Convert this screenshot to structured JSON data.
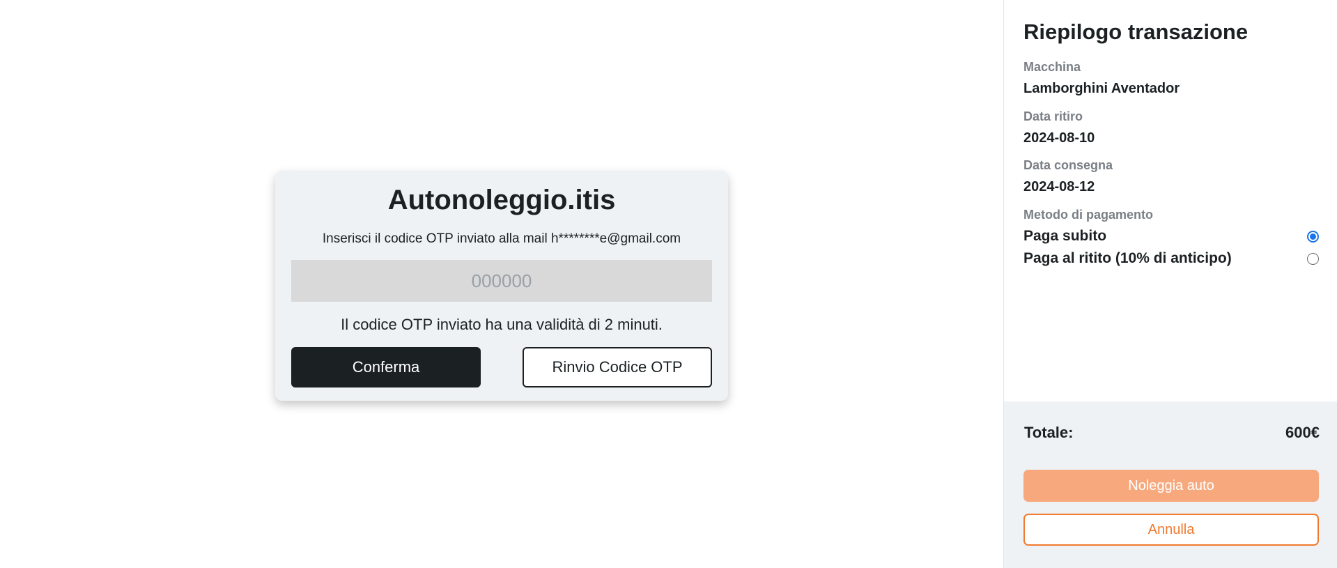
{
  "otp": {
    "title": "Autonoleggio.itis",
    "instructions": "Inserisci il codice OTP inviato alla mail h********e@gmail.com",
    "input_placeholder": "000000",
    "input_value": "",
    "validity": "Il codice OTP inviato ha una validità di 2 minuti.",
    "confirm_label": "Conferma",
    "resend_label": "Rinvio Codice OTP"
  },
  "summary": {
    "title": "Riepilogo transazione",
    "car_label": "Macchina",
    "car_value": "Lamborghini Aventador",
    "pickup_label": "Data ritiro",
    "pickup_value": "2024-08-10",
    "return_label": "Data consegna",
    "return_value": "2024-08-12",
    "payment_label": "Metodo di pagamento",
    "payment_options": [
      {
        "label": "Paga subito",
        "selected": true
      },
      {
        "label": "Paga al ritito (10% di anticipo)",
        "selected": false
      }
    ],
    "total_label": "Totale:",
    "total_value": "600€",
    "rent_label": "Noleggia auto",
    "cancel_label": "Annulla"
  },
  "colors": {
    "dark": "#1b2023",
    "card_bg": "#eff2f5",
    "input_bg": "#d9d9d9",
    "accent_orange": "#f07a30",
    "rent_button_bg": "#f7a97d",
    "radio_blue": "#1a73e8"
  }
}
